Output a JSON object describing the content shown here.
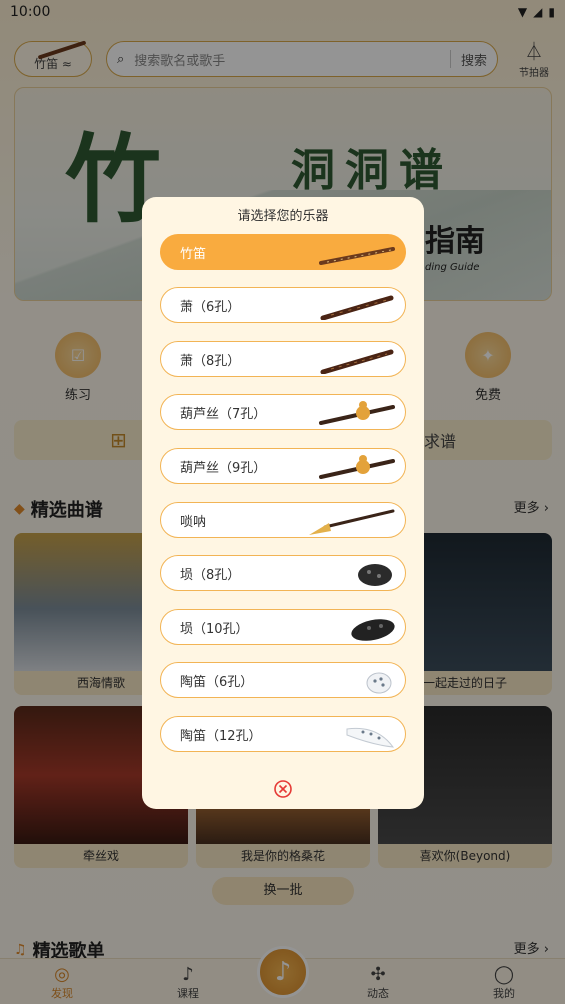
{
  "status_bar": {
    "time": "10:00"
  },
  "header": {
    "instrument_label": "竹笛 ≈",
    "search_placeholder": "搜索歌名或歌手",
    "search_button": "搜索",
    "metronome_label": "节拍器"
  },
  "banner": {
    "title_big": "竹",
    "title": "洞洞谱",
    "subtitle": "指南",
    "subtitle_en": "ding Guide"
  },
  "quick_entries": [
    {
      "label": "练习"
    },
    {
      "label": "免费"
    }
  ],
  "action_bar": {
    "request_label": "求谱"
  },
  "featured_scores": {
    "title": "精选曲谱",
    "more": "更多 ›",
    "items": [
      "西海情歌",
      "一起走过的日子",
      "牵丝戏",
      "我是你的格桑花",
      "喜欢你(Beyond)"
    ],
    "refresh": "换一批"
  },
  "featured_playlists": {
    "title": "精选歌单",
    "more": "更多 ›"
  },
  "tab_bar": [
    {
      "label": "发现",
      "icon": "discover-icon"
    },
    {
      "label": "课程",
      "icon": "course-icon"
    },
    {
      "label": "动态",
      "icon": "moments-icon"
    },
    {
      "label": "我的",
      "icon": "profile-icon"
    }
  ],
  "modal": {
    "title": "请选择您的乐器",
    "options": [
      {
        "label": "竹笛",
        "icon": "dizi-flute-icon",
        "selected": true
      },
      {
        "label": "萧（6孔）",
        "icon": "xiao-flute-icon"
      },
      {
        "label": "萧（8孔）",
        "icon": "xiao-flute-icon"
      },
      {
        "label": "葫芦丝（7孔）",
        "icon": "hulusi-icon"
      },
      {
        "label": "葫芦丝（9孔）",
        "icon": "hulusi-icon"
      },
      {
        "label": "唢呐",
        "icon": "suona-icon"
      },
      {
        "label": "埙（8孔）",
        "icon": "xun-icon"
      },
      {
        "label": "埙（10孔）",
        "icon": "xun-icon"
      },
      {
        "label": "陶笛（6孔）",
        "icon": "ocarina-icon"
      },
      {
        "label": "陶笛（12孔）",
        "icon": "ocarina-icon"
      }
    ]
  },
  "colors": {
    "accent": "#f9ab3f",
    "border": "#f2b455",
    "modal_bg": "#fff6e3",
    "close": "#e53935"
  }
}
